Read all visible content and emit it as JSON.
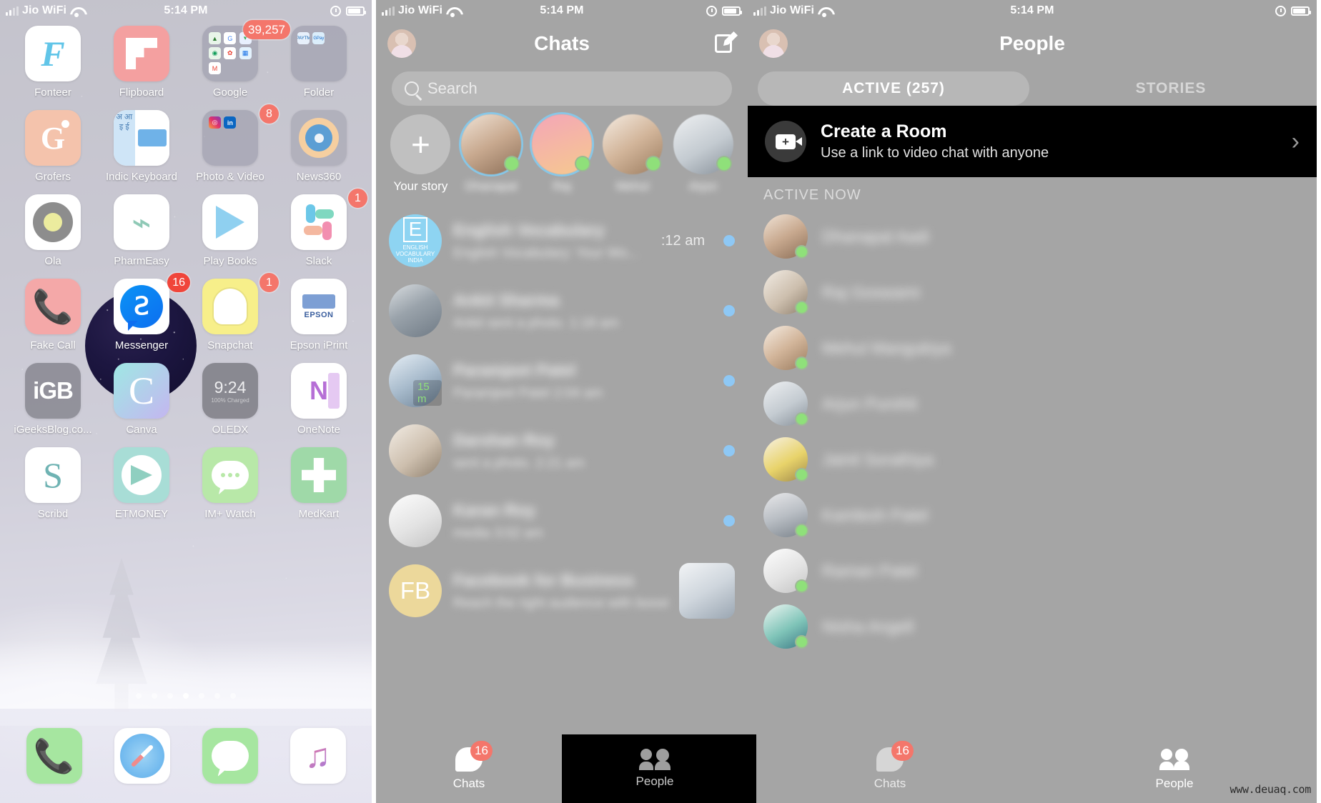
{
  "statusbar": {
    "carrier": "Jio WiFi",
    "time": "5:14 PM"
  },
  "homescreen": {
    "rows": [
      [
        {
          "label": "Fonteer",
          "icon": "fonteer-icon",
          "badge": null
        },
        {
          "label": "Flipboard",
          "icon": "flipboard-icon",
          "badge": null
        },
        {
          "label": "Google",
          "icon": "google-folder-icon",
          "badge": "39,257"
        },
        {
          "label": "Folder",
          "icon": "folder-icon",
          "badge": null
        }
      ],
      [
        {
          "label": "Grofers",
          "icon": "grofers-icon",
          "badge": null
        },
        {
          "label": "Indic Keyboard",
          "icon": "indic-keyboard-icon",
          "badge": null
        },
        {
          "label": "Photo & Video",
          "icon": "photo-video-folder-icon",
          "badge": "8"
        },
        {
          "label": "News360",
          "icon": "news360-icon",
          "badge": null
        }
      ],
      [
        {
          "label": "Ola",
          "icon": "ola-icon",
          "badge": null
        },
        {
          "label": "PharmEasy",
          "icon": "pharmeasy-icon",
          "badge": null
        },
        {
          "label": "Play Books",
          "icon": "play-books-icon",
          "badge": null
        },
        {
          "label": "Slack",
          "icon": "slack-icon",
          "badge": "1"
        }
      ],
      [
        {
          "label": "Fake Call",
          "icon": "fake-call-icon",
          "badge": null
        },
        {
          "label": "Messenger",
          "icon": "messenger-icon",
          "badge": "16"
        },
        {
          "label": "Snapchat",
          "icon": "snapchat-icon",
          "badge": "1"
        },
        {
          "label": "Epson iPrint",
          "icon": "epson-iprint-icon",
          "badge": null
        }
      ],
      [
        {
          "label": "iGeeksBlog.co...",
          "icon": "igeeksblog-icon",
          "badge": null
        },
        {
          "label": "Canva",
          "icon": "canva-icon",
          "badge": null
        },
        {
          "label": "OLEDX",
          "icon": "oledx-icon",
          "badge": null
        },
        {
          "label": "OneNote",
          "icon": "onenote-icon",
          "badge": null
        }
      ],
      [
        {
          "label": "Scribd",
          "icon": "scribd-icon",
          "badge": null
        },
        {
          "label": "ETMONEY",
          "icon": "etmoney-icon",
          "badge": null
        },
        {
          "label": "IM+ Watch",
          "icon": "im-plus-watch-icon",
          "badge": null
        },
        {
          "label": "MedKart",
          "icon": "medkart-icon",
          "badge": null
        }
      ]
    ],
    "oledx_time": "9:24",
    "oledx_sub": "100% Charged",
    "epson_text": "EPSON",
    "igb_text": "iGB",
    "indic_left": "अ आ इ ई",
    "page_dots": {
      "count": 7,
      "active_index": 3
    },
    "dock": [
      {
        "label": "Phone",
        "icon": "phone-icon"
      },
      {
        "label": "Safari",
        "icon": "safari-icon"
      },
      {
        "label": "Messages",
        "icon": "messages-icon"
      },
      {
        "label": "Music",
        "icon": "music-icon"
      }
    ]
  },
  "chats_screen": {
    "title": "Chats",
    "search_placeholder": "Search",
    "compose_icon": "compose-icon",
    "stories": [
      {
        "label": "Your story",
        "icon": "add-story-plus-icon",
        "ring": false,
        "active": false
      },
      {
        "label": "Dhanapal",
        "icon": "story-avatar",
        "ring": true,
        "active": true
      },
      {
        "label": "Raj",
        "icon": "story-avatar",
        "ring": true,
        "active": true
      },
      {
        "label": "Mehul",
        "icon": "story-avatar",
        "ring": false,
        "active": true
      },
      {
        "label": "Arjun",
        "icon": "story-avatar",
        "ring": false,
        "active": true
      }
    ],
    "rows": [
      {
        "name": "English Vocabulary",
        "preview": "English Vocabulary: Your Wo...",
        "time": ":12 am",
        "unread": true,
        "avatar": "english-vocabulary-logo",
        "thumb": false,
        "mini_badge": null
      },
      {
        "name": "Ankit Sharma",
        "preview": "Ankit sent a photo.  1:18 am",
        "time": "",
        "unread": true,
        "avatar": "contact-photo",
        "thumb": false,
        "mini_badge": null
      },
      {
        "name": "Paramjeet Patel",
        "preview": "Paramjeet Patel  2:04 am",
        "time": "",
        "unread": true,
        "avatar": "contact-photo",
        "thumb": false,
        "mini_badge": "15 m"
      },
      {
        "name": "Darshan Roy",
        "preview": "sent a photo.  2:21 am",
        "time": "",
        "unread": true,
        "avatar": "contact-photo",
        "thumb": false,
        "mini_badge": null
      },
      {
        "name": "Karan Roy",
        "preview": "media  3:02 am",
        "time": "",
        "unread": true,
        "avatar": "contact-photo",
        "thumb": false,
        "mini_badge": null
      },
      {
        "name": "Facebook for Business",
        "preview": "Reach the right audience with boosted posts",
        "time": "",
        "unread": false,
        "avatar": "facebook-business-logo",
        "thumb": true,
        "mini_badge": null
      }
    ],
    "tabs": [
      {
        "label": "Chats",
        "icon": "chats-tab-icon",
        "badge": "16",
        "active": true
      },
      {
        "label": "People",
        "icon": "people-tab-icon",
        "badge": null,
        "active": false
      }
    ]
  },
  "people_screen": {
    "title": "People",
    "segments": [
      {
        "label": "ACTIVE (257)",
        "active": true
      },
      {
        "label": "STORIES",
        "active": false
      }
    ],
    "room_card": {
      "title": "Create a Room",
      "subtitle": "Use a link to video chat with anyone",
      "icon": "video-room-plus-icon",
      "chevron": "chevron-right-icon"
    },
    "active_now_header": "ACTIVE NOW",
    "people": [
      {
        "name": "Dhanapal Aadi",
        "online": true,
        "avatar": "contact-photo"
      },
      {
        "name": "Raj Goswami",
        "online": true,
        "avatar": "contact-photo"
      },
      {
        "name": "Mehul Mangukiya",
        "online": true,
        "avatar": "contact-photo"
      },
      {
        "name": "Arjun Purohit",
        "online": true,
        "avatar": "contact-photo"
      },
      {
        "name": "Jainil Sorathiya",
        "online": true,
        "avatar": "contact-photo"
      },
      {
        "name": "Kamlesh Patel",
        "online": true,
        "avatar": "contact-photo"
      },
      {
        "name": "Raman Patel",
        "online": true,
        "avatar": "contact-photo"
      },
      {
        "name": "Nisha Angell",
        "online": true,
        "avatar": "contact-photo"
      }
    ],
    "tabs": [
      {
        "label": "Chats",
        "icon": "chats-tab-icon",
        "badge": "16",
        "active": false
      },
      {
        "label": "People",
        "icon": "people-tab-icon",
        "badge": null,
        "active": true
      }
    ]
  },
  "watermark": "www.deuaq.com",
  "colors": {
    "badge_red": "#f4766b",
    "unread_blue": "#8ec8f5",
    "online_green": "#8fe07a",
    "messenger_blue": "#0d6ef0"
  }
}
